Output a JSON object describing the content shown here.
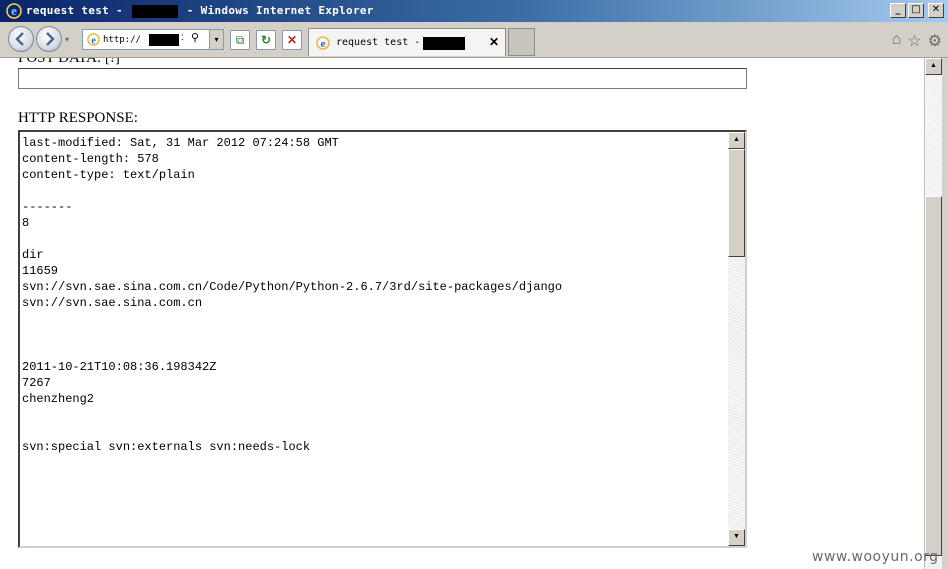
{
  "window": {
    "title_prefix": "request test -",
    "title_suffix": "- Windows Internet Explorer",
    "minimize_glyph": "_",
    "maximize_glyph": "□",
    "close_glyph": "✕"
  },
  "nav": {
    "address_value": "http://",
    "address_colon": ":",
    "search_glyph": "⚲",
    "dropdown_glyph": "▾",
    "arrow_glyph": "▾",
    "compat_glyph": "⧉",
    "refresh_glyph": "↻",
    "stop_glyph": "✕"
  },
  "tab": {
    "label": "request test -",
    "close_glyph": "✕"
  },
  "toolbar_icons": {
    "home_glyph": "⌂",
    "favorites_glyph": "☆",
    "tools_glyph": "⚙"
  },
  "page": {
    "post_label": "POST DATA: [!]",
    "post_value": "",
    "response_label": "HTTP RESPONSE:",
    "response_lines": [
      "last-modified: Sat, 31 Mar 2012 07:24:58 GMT",
      "content-length: 578",
      "content-type: text/plain",
      "",
      "-------",
      "8",
      "",
      "dir",
      "11659",
      "svn://svn.sae.sina.com.cn/Code/Python/Python-2.6.7/3rd/site-packages/django",
      "svn://svn.sae.sina.com.cn",
      "",
      "",
      "",
      "2011-10-21T10:08:36.198342Z",
      "7267",
      "chenzheng2",
      "",
      "",
      "svn:special svn:externals svn:needs-lock"
    ],
    "scroll_up_glyph": "▲",
    "scroll_down_glyph": "▼"
  },
  "watermark": "www.wooyun.org"
}
